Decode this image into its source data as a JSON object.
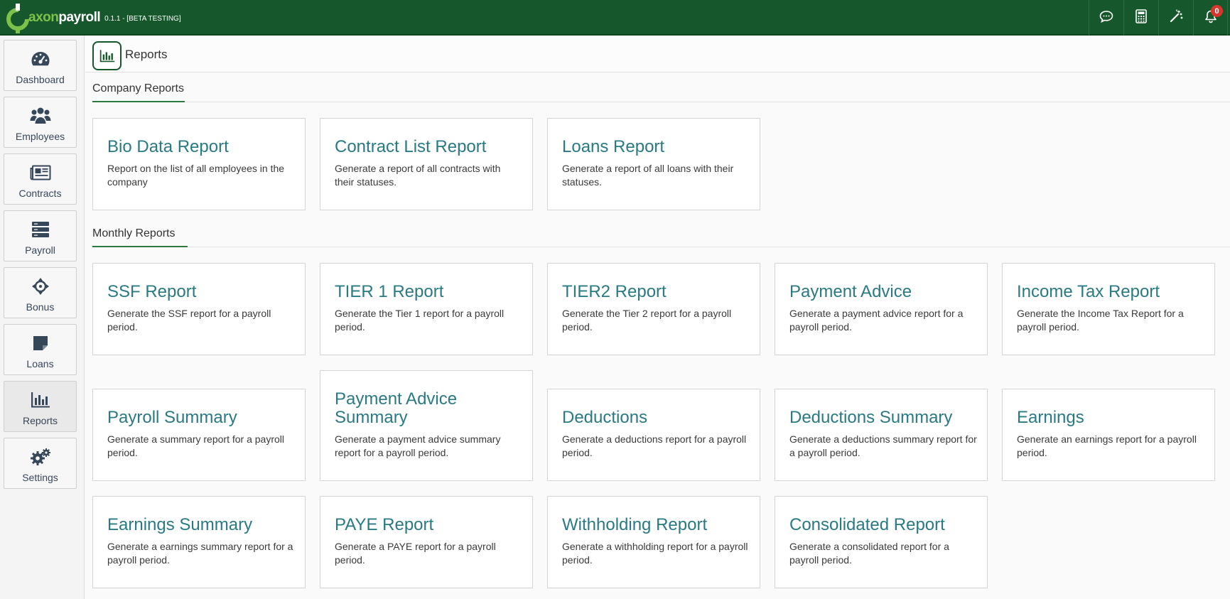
{
  "app": {
    "brand_axon": "axon",
    "brand_payroll": "payroll",
    "version": "0.1.1 - [BETA TESTING]",
    "notification_count": "0",
    "colors": {
      "header": "#17572c",
      "accent": "#2c7a3f",
      "card_title": "#297a83",
      "badge": "#d9362b"
    }
  },
  "topbar": {
    "icons": [
      "chat-icon",
      "calculator-icon",
      "magic-wand-icon",
      "bell-icon"
    ]
  },
  "sidebar": {
    "items": [
      {
        "label": "Dashboard",
        "icon": "dashboard-icon"
      },
      {
        "label": "Employees",
        "icon": "users-icon"
      },
      {
        "label": "Contracts",
        "icon": "newspaper-icon"
      },
      {
        "label": "Payroll",
        "icon": "list-icon"
      },
      {
        "label": "Bonus",
        "icon": "crosshair-icon"
      },
      {
        "label": "Loans",
        "icon": "sticky-note-icon"
      },
      {
        "label": "Reports",
        "icon": "bar-chart-icon",
        "active": true
      },
      {
        "label": "Settings",
        "icon": "gears-icon"
      }
    ]
  },
  "page": {
    "title": "Reports"
  },
  "sections": [
    {
      "title": "Company Reports",
      "cards": [
        {
          "title": "Bio Data Report",
          "desc": "Report on the list of all employees in the company"
        },
        {
          "title": "Contract List Report",
          "desc": "Generate a report of all contracts with their statuses."
        },
        {
          "title": "Loans Report",
          "desc": "Generate a report of all loans with their statuses."
        }
      ]
    },
    {
      "title": "Monthly Reports",
      "cards": [
        {
          "title": "SSF Report",
          "desc": "Generate the SSF report for a payroll period."
        },
        {
          "title": "TIER 1 Report",
          "desc": "Generate the Tier 1 report for a payroll period."
        },
        {
          "title": "TIER2 Report",
          "desc": "Generate the Tier 2 report for a payroll period."
        },
        {
          "title": "Payment Advice",
          "desc": "Generate a payment advice report for a payroll period."
        },
        {
          "title": "Income Tax Report",
          "desc": "Generate the Income Tax Report for a payroll period."
        },
        {
          "title": "Payroll Summary",
          "desc": "Generate a summary report for a payroll period."
        },
        {
          "title": "Payment Advice Summary",
          "desc": "Generate a payment advice summary report for a payroll period."
        },
        {
          "title": "Deductions",
          "desc": "Generate a deductions report for a payroll period."
        },
        {
          "title": "Deductions Summary",
          "desc": "Generate a deductions summary report for a payroll period."
        },
        {
          "title": "Earnings",
          "desc": "Generate an earnings report for a payroll period."
        },
        {
          "title": "Earnings Summary",
          "desc": "Generate a earnings summary report for a payroll period."
        },
        {
          "title": "PAYE Report",
          "desc": "Generate a PAYE report for a payroll period."
        },
        {
          "title": "Withholding Report",
          "desc": "Generate a withholding report for a payroll period."
        },
        {
          "title": "Consolidated Report",
          "desc": "Generate a consolidated report for a payroll period."
        }
      ]
    }
  ]
}
